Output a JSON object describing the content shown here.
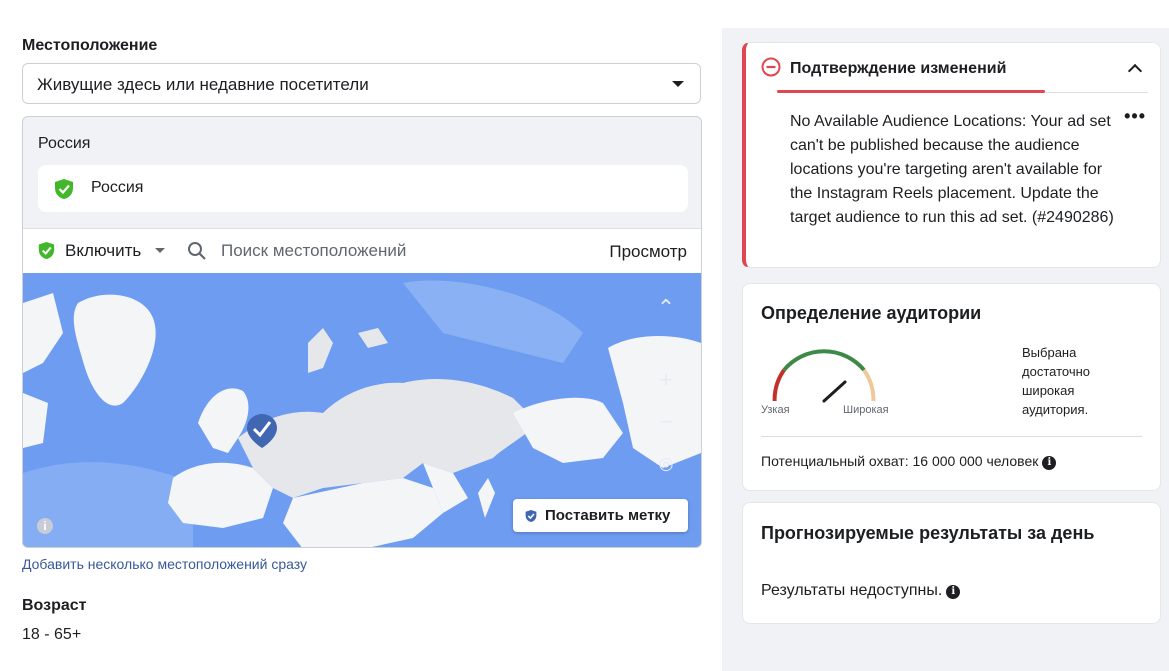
{
  "location": {
    "section_label": "Местоположение",
    "dropdown_value": "Живущие здесь или недавние посетители",
    "country_title": "Россия",
    "selected_chip": "Россия",
    "include_label": "Включить",
    "search_placeholder": "Поиск местоположений",
    "preview_label": "Просмотр",
    "put_mark_label": "Поставить метку",
    "map_controls": [
      "chevron-up-icon",
      "zoom-in-icon",
      "zoom-out-icon",
      "locate-icon"
    ],
    "add_multiple_link": "Добавить несколько местоположений сразу"
  },
  "age": {
    "label": "Возраст",
    "value": "18 - 65+"
  },
  "error_card": {
    "title": "Подтверждение изменений",
    "message": "No Available Audience Locations: Your ad set can't be published because the audience locations you're targeting aren't available for the Instagram Reels placement. Update the target audience to run this ad set. (#2490286)",
    "more": "•••"
  },
  "audience_card": {
    "title": "Определение аудитории",
    "narrow_label": "Узкая",
    "wide_label": "Широкая",
    "description": "Выбрана достаточно широкая аудитория.",
    "reach": "Потенциальный охват: 16 000 000 человек"
  },
  "forecast_card": {
    "title": "Прогнозируемые результаты за день",
    "text": "Результаты недоступны."
  },
  "colors": {
    "accent_green": "#42b72a",
    "error_red": "#e0464f",
    "link_blue": "#385898",
    "map_ocean": "#6d9cf1",
    "map_land": "#f4f5f7",
    "marker": "#4267b2"
  }
}
